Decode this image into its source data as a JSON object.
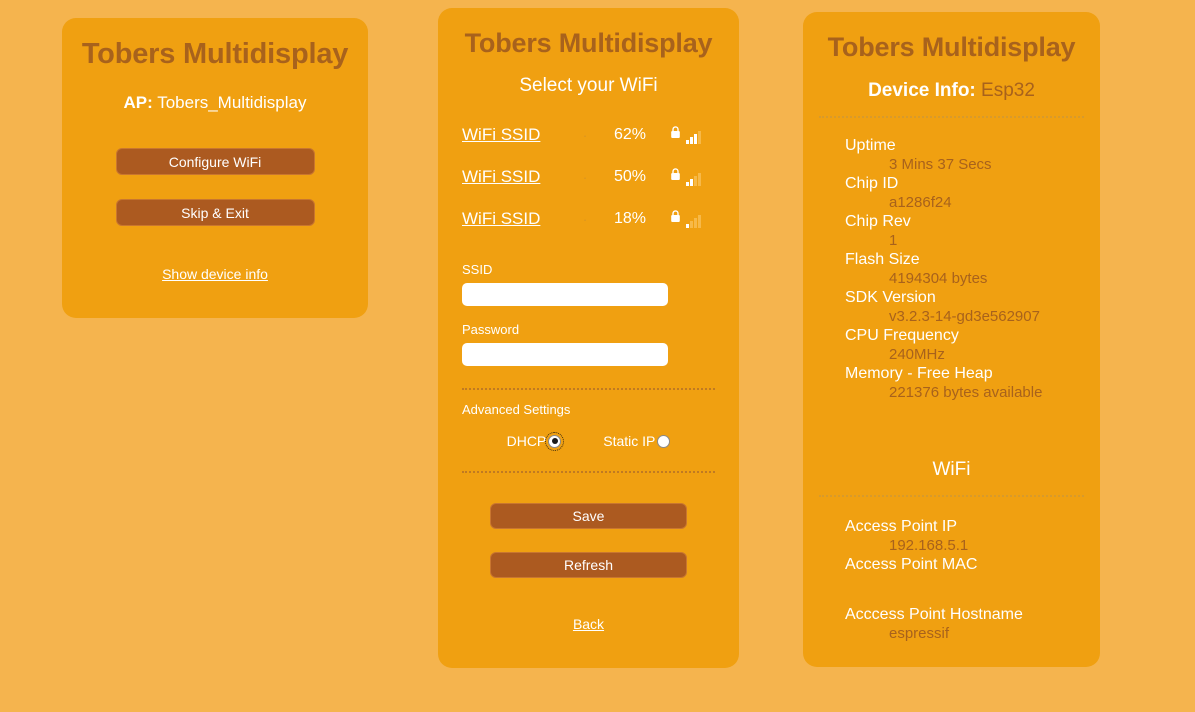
{
  "colors": {
    "page_background": "#f5b44e",
    "card_background": "#f0a011",
    "heading_brown": "#a8621c",
    "button_brown": "#ac5a20",
    "text_white": "#ffffff"
  },
  "left_panel": {
    "title": "Tobers Multidisplay",
    "ap_label": "AP:",
    "ap_value": "Tobers_Multidisplay",
    "configure_wifi_label": "Configure WiFi",
    "skip_exit_label": "Skip & Exit",
    "show_device_info_label": "Show device info"
  },
  "middle_panel": {
    "title": "Tobers Multidisplay",
    "subtitle": "Select your WiFi",
    "separator_dot": "·",
    "networks": [
      {
        "ssid": "WiFi SSID",
        "percent": "62%",
        "lock": "lock-icon",
        "bars_filled": 3
      },
      {
        "ssid": "WiFi SSID",
        "percent": "50%",
        "lock": "lock-icon",
        "bars_filled": 2
      },
      {
        "ssid": "WiFi SSID",
        "percent": "18%",
        "lock": "lock-icon",
        "bars_filled": 1
      }
    ],
    "ssid_field": {
      "label": "SSID",
      "value": "",
      "placeholder": ""
    },
    "password_field": {
      "label": "Password",
      "value": "",
      "placeholder": ""
    },
    "advanced_settings_label": "Advanced Settings",
    "ip_mode": {
      "dhcp_label": "DHCP",
      "static_label": "Static IP",
      "selected": "DHCP"
    },
    "save_label": "Save",
    "refresh_label": "Refresh",
    "back_label": "Back"
  },
  "right_panel": {
    "title": "Tobers Multidisplay",
    "device_info_label": "Device Info:",
    "device_info_value": "Esp32",
    "device_rows": [
      {
        "key": "Uptime",
        "value": "3 Mins 37 Secs"
      },
      {
        "key": "Chip ID",
        "value": "a1286f24"
      },
      {
        "key": "Chip Rev",
        "value": "1"
      },
      {
        "key": "Flash Size",
        "value": "4194304 bytes"
      },
      {
        "key": "SDK Version",
        "value": "v3.2.3-14-gd3e562907"
      },
      {
        "key": "CPU Frequency",
        "value": "240MHz"
      },
      {
        "key": "Memory - Free Heap",
        "value": "221376 bytes available"
      }
    ],
    "wifi_heading": "WiFi",
    "wifi_rows": [
      {
        "key": "Access Point IP",
        "value": "192.168.5.1"
      },
      {
        "key": "Access Point MAC",
        "value": ""
      },
      {
        "key": "Acccess Point Hostname",
        "value": "espressif"
      }
    ]
  }
}
